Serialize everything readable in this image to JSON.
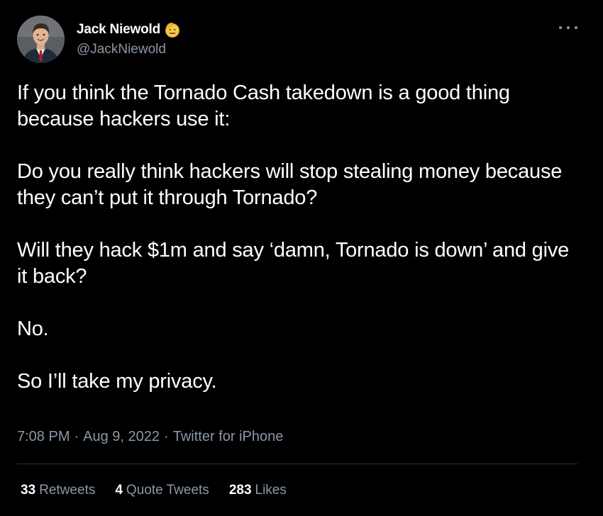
{
  "author": {
    "display_name": "Jack Niewold",
    "handle": "@JackNiewold",
    "avatar_icon": "profile-photo",
    "badge_icon": "saluting-face-emoji"
  },
  "tweet": {
    "paragraphs": [
      "If you think the Tornado Cash takedown is a good thing because hackers use it:",
      "Do you really think hackers will stop stealing money because they can’t put it through Tornado?",
      "Will they hack $1m and say ‘damn, Tornado is down’ and give it back?",
      "No.",
      "So I’ll take my privacy."
    ],
    "time": "7:08 PM",
    "date": "Aug 9, 2022",
    "source": "Twitter for iPhone",
    "separator": "·"
  },
  "stats": {
    "retweets_count": "33",
    "retweets_label": "Retweets",
    "quotes_count": "4",
    "quotes_label": "Quote Tweets",
    "likes_count": "283",
    "likes_label": "Likes"
  },
  "colors": {
    "background": "#000000",
    "primary_text": "#ffffff",
    "secondary_text": "#8b98a5",
    "divider": "#2f3336"
  }
}
